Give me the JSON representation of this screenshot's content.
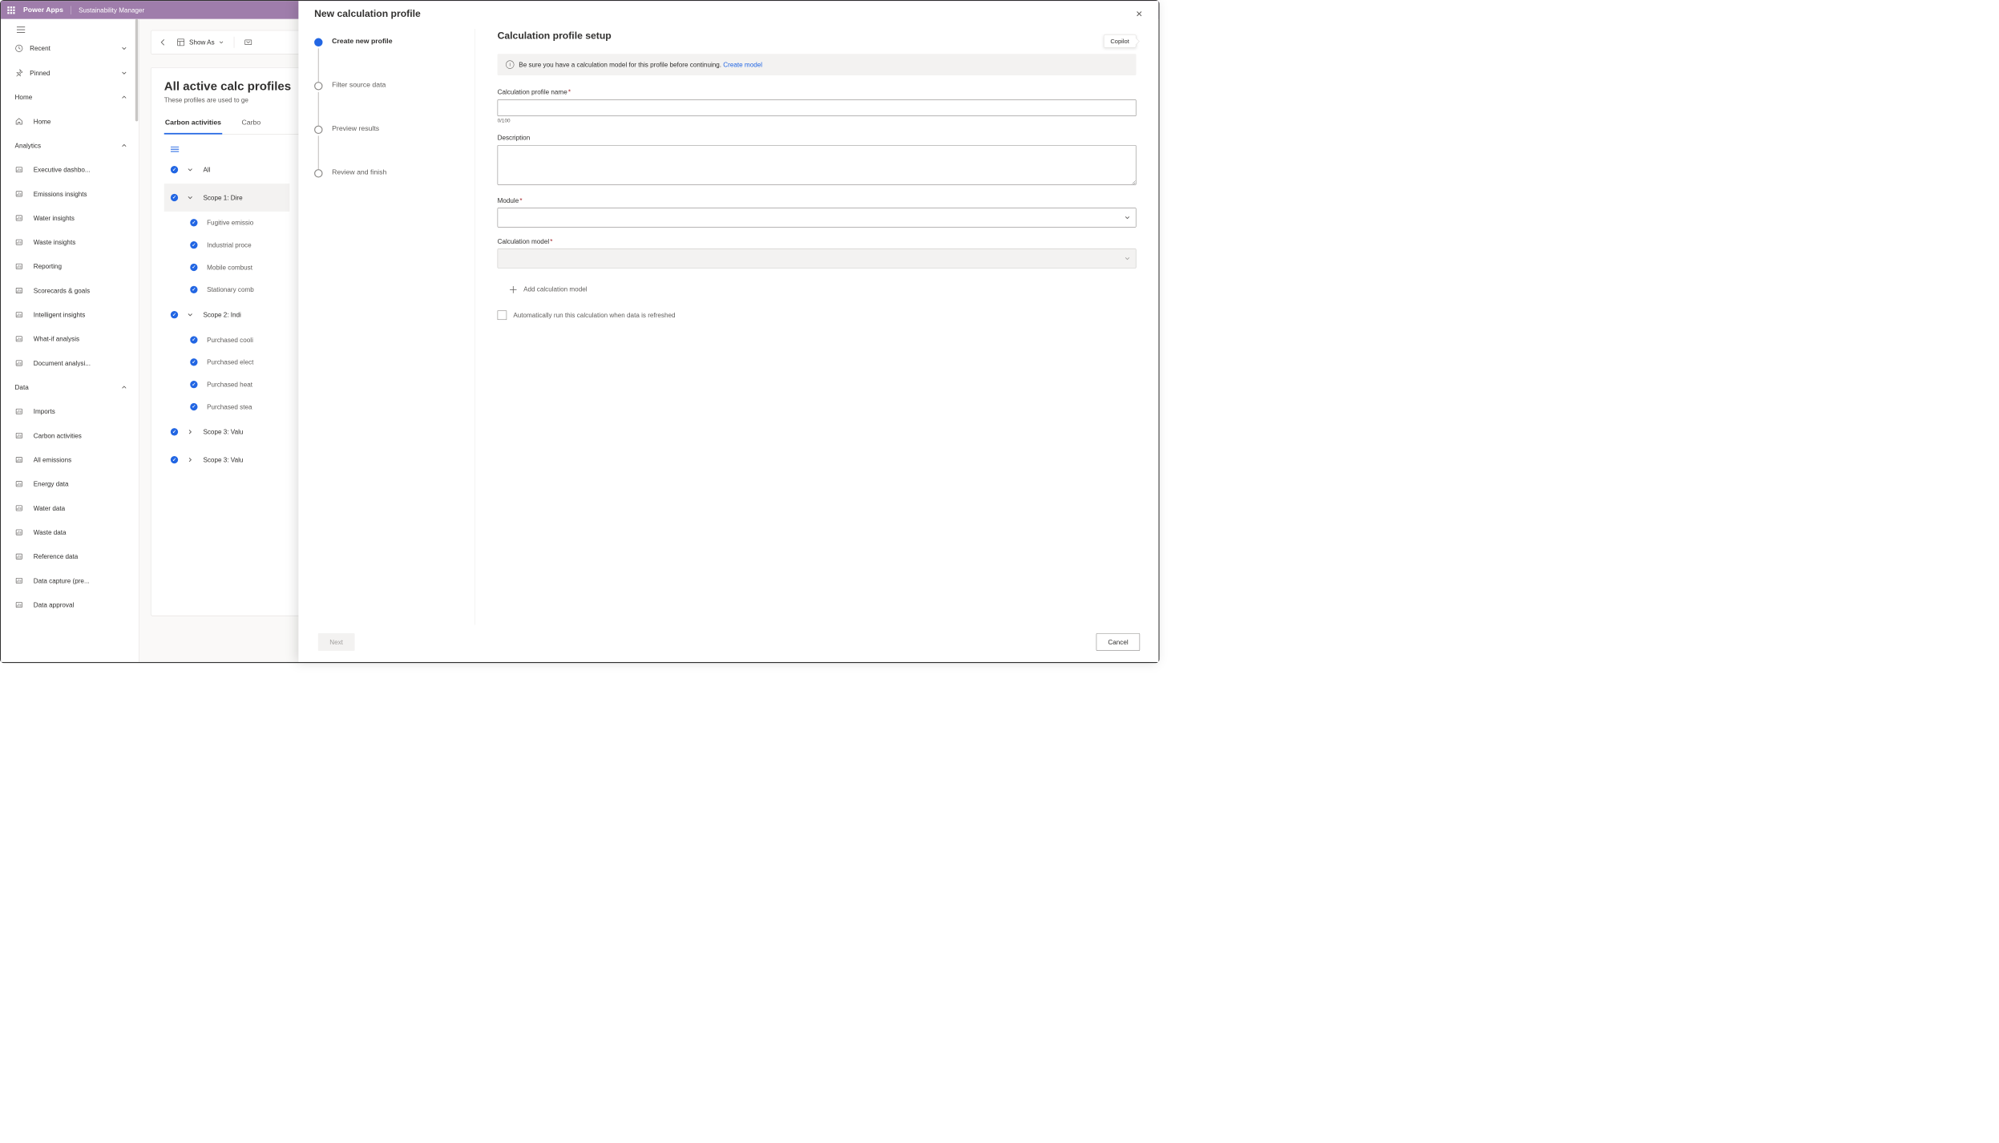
{
  "topbar": {
    "app": "Power Apps",
    "sub": "Sustainability Manager"
  },
  "leftnav": {
    "pinned_items": [
      {
        "label": "Recent",
        "icon": "clock"
      },
      {
        "label": "Pinned",
        "icon": "pin"
      }
    ],
    "sections": [
      {
        "label": "Home",
        "items": [
          {
            "label": "Home",
            "icon": "home"
          }
        ]
      },
      {
        "label": "Analytics",
        "items": [
          {
            "label": "Executive dashbo...",
            "icon": "chart"
          },
          {
            "label": "Emissions insights",
            "icon": "chart"
          },
          {
            "label": "Water insights",
            "icon": "chart"
          },
          {
            "label": "Waste insights",
            "icon": "chart"
          },
          {
            "label": "Reporting",
            "icon": "doc"
          },
          {
            "label": "Scorecards & goals",
            "icon": "trend"
          },
          {
            "label": "Intelligent insights",
            "icon": "spark"
          },
          {
            "label": "What-if analysis",
            "icon": "bulb"
          },
          {
            "label": "Document analysi...",
            "icon": "scan"
          }
        ]
      },
      {
        "label": "Data",
        "items": [
          {
            "label": "Imports",
            "icon": "import"
          },
          {
            "label": "Carbon activities",
            "icon": "co2"
          },
          {
            "label": "All emissions",
            "icon": "list"
          },
          {
            "label": "Energy data",
            "icon": "battery"
          },
          {
            "label": "Water data",
            "icon": "drop"
          },
          {
            "label": "Waste data",
            "icon": "trash"
          },
          {
            "label": "Reference data",
            "icon": "ref"
          },
          {
            "label": "Data capture (pre...",
            "icon": "capture"
          },
          {
            "label": "Data approval",
            "icon": "approve"
          }
        ]
      }
    ]
  },
  "commandbar": {
    "show_as": "Show As"
  },
  "page": {
    "title": "All active calc profiles",
    "description": "These profiles are used to ge",
    "tabs": [
      "Carbon activities",
      "Carbo"
    ],
    "tree": {
      "all": "All",
      "groups": [
        {
          "label": "Scope 1: Dire",
          "expanded": true,
          "children": [
            "Fugitive emissio",
            "Industrial proce",
            "Mobile combust",
            "Stationary comb"
          ]
        },
        {
          "label": "Scope 2: Indi",
          "expanded": true,
          "children": [
            "Purchased cooli",
            "Purchased elect",
            "Purchased heat",
            "Purchased stea"
          ]
        },
        {
          "label": "Scope 3: Valu",
          "expanded": false
        },
        {
          "label": "Scope 3: Valu",
          "expanded": false
        }
      ]
    }
  },
  "panel": {
    "title": "New calculation profile",
    "copilot": "Copilot",
    "steps": [
      "Create new profile",
      "Filter source data",
      "Preview results",
      "Review and finish"
    ],
    "form": {
      "heading": "Calculation profile setup",
      "info_text": "Be sure you have a calculation model for this profile before continuing. ",
      "info_link": "Create model",
      "name_label": "Calculation profile name",
      "name_counter": "0/100",
      "desc_label": "Description",
      "module_label": "Module",
      "model_label": "Calculation model",
      "add_model": "Add calculation model",
      "auto_label": "Automatically run this calculation when data is refreshed"
    },
    "footer": {
      "next": "Next",
      "cancel": "Cancel"
    }
  }
}
